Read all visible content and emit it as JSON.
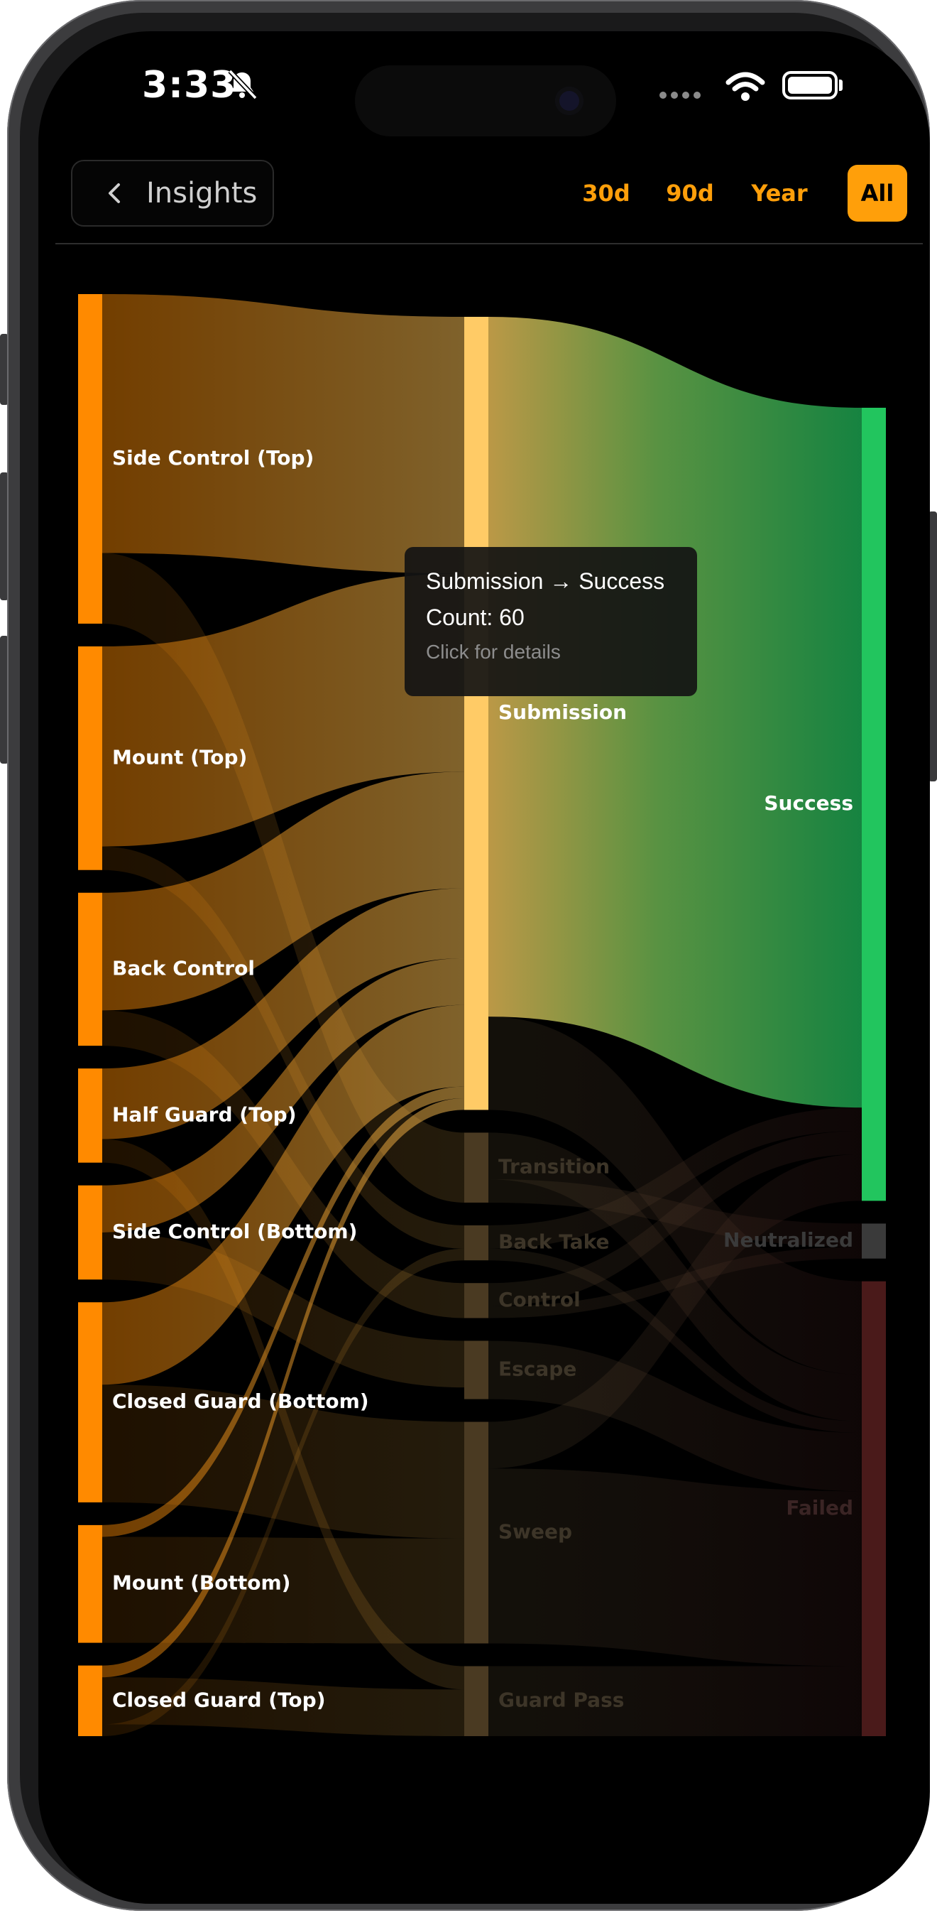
{
  "status_bar": {
    "time": "3:33"
  },
  "header": {
    "back_label": "Insights",
    "ranges": [
      {
        "label": "30d",
        "active": false
      },
      {
        "label": "90d",
        "active": false
      },
      {
        "label": "Year",
        "active": false
      },
      {
        "label": "All",
        "active": true
      }
    ]
  },
  "tooltip": {
    "title": "Submission → Success",
    "count": "Count: 60",
    "hint": "Click for details"
  },
  "colors": {
    "accent": "#ff9f0a",
    "source_bar": "#ff8a00",
    "success": "#22c55e",
    "neutral": "#3a3a3a",
    "failed": "#4a1a1a"
  },
  "chart_data": {
    "type": "sankey",
    "columns": [
      [
        "Side Control (Top)",
        "Mount (Top)",
        "Back Control",
        "Half Guard (Top)",
        "Side Control (Bottom)",
        "Closed Guard (Bottom)",
        "Mount (Bottom)",
        "Closed Guard (Top)"
      ],
      [
        "Submission",
        "Transition",
        "Back Take",
        "Control",
        "Escape",
        "Sweep",
        "Guard Pass"
      ],
      [
        "Success",
        "Neutralized",
        "Failed"
      ]
    ],
    "nodes": [
      {
        "name": "Side Control (Top)",
        "column": 0,
        "value": 28
      },
      {
        "name": "Mount (Top)",
        "column": 0,
        "value": 19
      },
      {
        "name": "Back Control",
        "column": 0,
        "value": 13
      },
      {
        "name": "Half Guard (Top)",
        "column": 0,
        "value": 8
      },
      {
        "name": "Side Control (Bottom)",
        "column": 0,
        "value": 8
      },
      {
        "name": "Closed Guard (Bottom)",
        "column": 0,
        "value": 17
      },
      {
        "name": "Mount (Bottom)",
        "column": 0,
        "value": 10
      },
      {
        "name": "Closed Guard (Top)",
        "column": 0,
        "value": 6
      },
      {
        "name": "Submission",
        "column": 1,
        "value": 68
      },
      {
        "name": "Transition",
        "column": 1,
        "value": 6
      },
      {
        "name": "Back Take",
        "column": 1,
        "value": 3
      },
      {
        "name": "Control",
        "column": 1,
        "value": 3
      },
      {
        "name": "Escape",
        "column": 1,
        "value": 5
      },
      {
        "name": "Sweep",
        "column": 1,
        "value": 19
      },
      {
        "name": "Guard Pass",
        "column": 1,
        "value": 6
      },
      {
        "name": "Success",
        "column": 2,
        "value": 68
      },
      {
        "name": "Neutralized",
        "column": 2,
        "value": 3
      },
      {
        "name": "Failed",
        "column": 2,
        "value": 39
      }
    ],
    "links": [
      {
        "source": "Side Control (Top)",
        "target": "Submission",
        "value": 22
      },
      {
        "source": "Side Control (Top)",
        "target": "Transition",
        "value": 6
      },
      {
        "source": "Mount (Top)",
        "target": "Submission",
        "value": 17
      },
      {
        "source": "Mount (Top)",
        "target": "Back Take",
        "value": 2
      },
      {
        "source": "Back Control",
        "target": "Submission",
        "value": 10
      },
      {
        "source": "Back Control",
        "target": "Control",
        "value": 3
      },
      {
        "source": "Half Guard (Top)",
        "target": "Submission",
        "value": 6
      },
      {
        "source": "Half Guard (Top)",
        "target": "Guard Pass",
        "value": 2
      },
      {
        "source": "Side Control (Bottom)",
        "target": "Submission",
        "value": 4
      },
      {
        "source": "Side Control (Bottom)",
        "target": "Escape",
        "value": 4
      },
      {
        "source": "Closed Guard (Bottom)",
        "target": "Submission",
        "value": 7
      },
      {
        "source": "Closed Guard (Bottom)",
        "target": "Sweep",
        "value": 10
      },
      {
        "source": "Mount (Bottom)",
        "target": "Submission",
        "value": 1
      },
      {
        "source": "Mount (Bottom)",
        "target": "Sweep",
        "value": 9
      },
      {
        "source": "Closed Guard (Top)",
        "target": "Submission",
        "value": 1
      },
      {
        "source": "Closed Guard (Top)",
        "target": "Guard Pass",
        "value": 4
      },
      {
        "source": "Closed Guard (Top)",
        "target": "Back Take",
        "value": 1
      },
      {
        "source": "Submission",
        "target": "Success",
        "value": 60
      },
      {
        "source": "Submission",
        "target": "Failed",
        "value": 8
      },
      {
        "source": "Transition",
        "target": "Failed",
        "value": 4
      },
      {
        "source": "Transition",
        "target": "Neutralized",
        "value": 2
      },
      {
        "source": "Back Take",
        "target": "Success",
        "value": 2
      },
      {
        "source": "Back Take",
        "target": "Failed",
        "value": 1
      },
      {
        "source": "Control",
        "target": "Success",
        "value": 2
      },
      {
        "source": "Control",
        "target": "Neutralized",
        "value": 1
      },
      {
        "source": "Escape",
        "target": "Failed",
        "value": 5
      },
      {
        "source": "Sweep",
        "target": "Success",
        "value": 4
      },
      {
        "source": "Sweep",
        "target": "Failed",
        "value": 15
      },
      {
        "source": "Guard Pass",
        "target": "Failed",
        "value": 6
      }
    ],
    "highlighted_link": {
      "source": "Submission",
      "target": "Success"
    }
  }
}
